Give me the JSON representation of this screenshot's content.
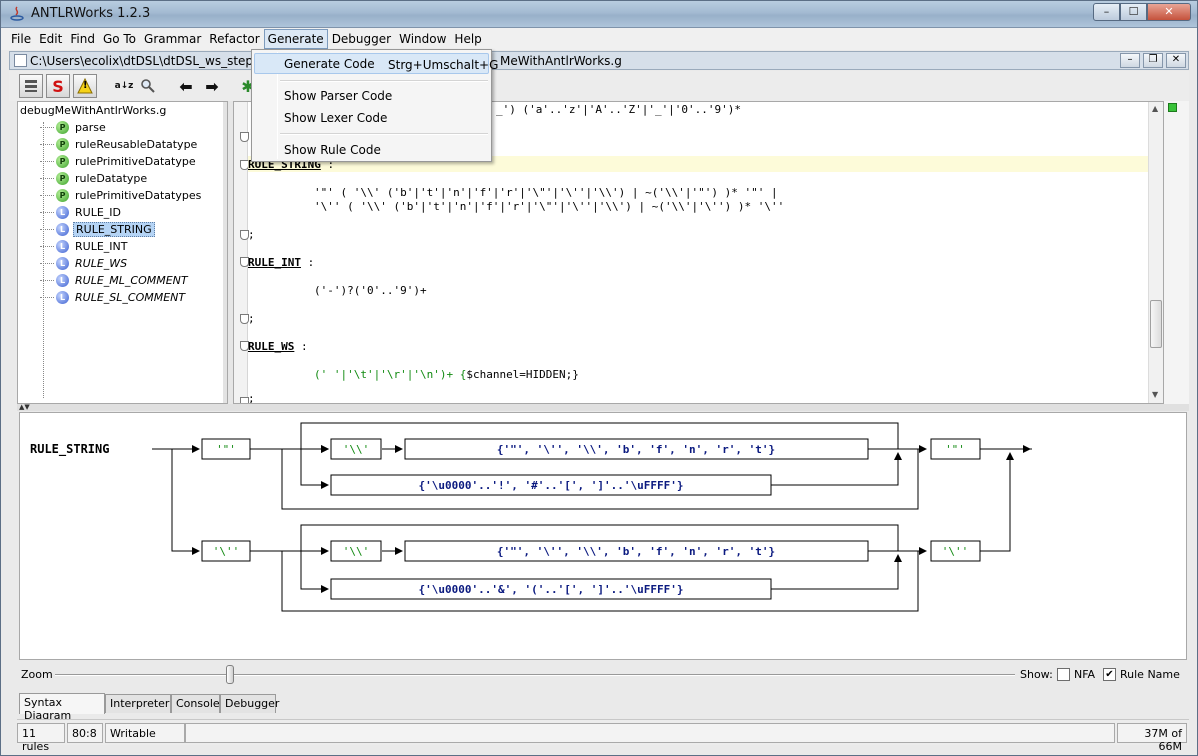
{
  "window": {
    "title": "ANTLRWorks 1.2.3",
    "minimize": "–",
    "maximize": "☐",
    "close": "✕"
  },
  "menubar": [
    "File",
    "Edit",
    "Find",
    "Go To",
    "Grammar",
    "Refactor",
    "Generate",
    "Debugger",
    "Window",
    "Help"
  ],
  "document": {
    "path": "C:\\Users\\ecolix\\dtDSL\\dtDSL_ws_step_3\\d",
    "path_tail": "MeWithAntlrWorks.g"
  },
  "toolbar": {
    "s_label": "S",
    "warn_label": "!",
    "sort_label": "a↓z",
    "back_label": "⬅",
    "forward_label": "➡"
  },
  "tree": {
    "root": "debugMeWithAntlrWorks.g",
    "items": [
      {
        "badge": "P",
        "label": "parse"
      },
      {
        "badge": "P",
        "label": "ruleReusableDatatype"
      },
      {
        "badge": "P",
        "label": "rulePrimitiveDatatype"
      },
      {
        "badge": "P",
        "label": "ruleDatatype"
      },
      {
        "badge": "P",
        "label": "rulePrimitiveDatatypes"
      },
      {
        "badge": "L",
        "label": "RULE_ID"
      },
      {
        "badge": "L",
        "label": "RULE_STRING"
      },
      {
        "badge": "L",
        "label": "RULE_INT"
      },
      {
        "badge": "L",
        "label": "RULE_WS"
      },
      {
        "badge": "L",
        "label": "RULE_ML_COMMENT"
      },
      {
        "badge": "L",
        "label": "RULE_SL_COMMENT"
      }
    ]
  },
  "editor": {
    "line_id_tail": "_') ('a'..'z'|'A'..'Z'|'_'|'0'..'9')*",
    "rule_string": "RULE_STRING",
    "rule_string_colon": " :",
    "str_alt1": "'\"' ( '\\\\' ('b'|'t'|'n'|'f'|'r'|'\\\"'|'\\''|'\\\\') | ~('\\\\'|'\"') )* '\"' |",
    "str_alt2": "'\\'' ( '\\\\' ('b'|'t'|'n'|'f'|'r'|'\\\"'|'\\''|'\\\\') | ~('\\\\'|'\\'') )* '\\''",
    "semi1": ";",
    "rule_int": "RULE_INT",
    "rule_int_colon": " :",
    "int_body": "('-')?('0'..'9')+",
    "semi2": ";",
    "rule_ws": "RULE_WS",
    "rule_ws_colon": " :",
    "ws_body_a": "(' '|'\\t'|'\\r'|'\\n')+ {",
    "ws_body_b": "$channel=HIDDEN;}",
    "semi3": ";"
  },
  "diagram": {
    "rule": "RULE_STRING",
    "dq": "'\"'",
    "sq": "'\\''",
    "bs": "'\\\\'",
    "esc_set": "{'\"', '\\'', '\\\\', 'b', 'f', 'n', 'r', 't'}",
    "range_dq": "{'\\u0000'..'!', '#'..'[', ']'..'\\uFFFF'}",
    "range_sq": "{'\\u0000'..'&', '('..'[', ']'..'\\uFFFF'}"
  },
  "zoom": {
    "label": "Zoom",
    "show_label": "Show:",
    "nfa_label": "NFA",
    "nfa_checked": false,
    "rule_name_label": "Rule Name",
    "rule_name_checked": true,
    "check_mark": "✔"
  },
  "tabs": [
    "Syntax Diagram",
    "Interpreter",
    "Console",
    "Debugger"
  ],
  "status": {
    "rules": "11 rules",
    "position": "80:8",
    "mode": "Writable",
    "memory": "37M of 66M"
  },
  "generate_menu": {
    "generate_code": "Generate Code",
    "generate_code_accel": "Strg+Umschalt+G",
    "show_parser": "Show Parser Code",
    "show_lexer": "Show Lexer Code",
    "show_rule": "Show Rule Code"
  }
}
